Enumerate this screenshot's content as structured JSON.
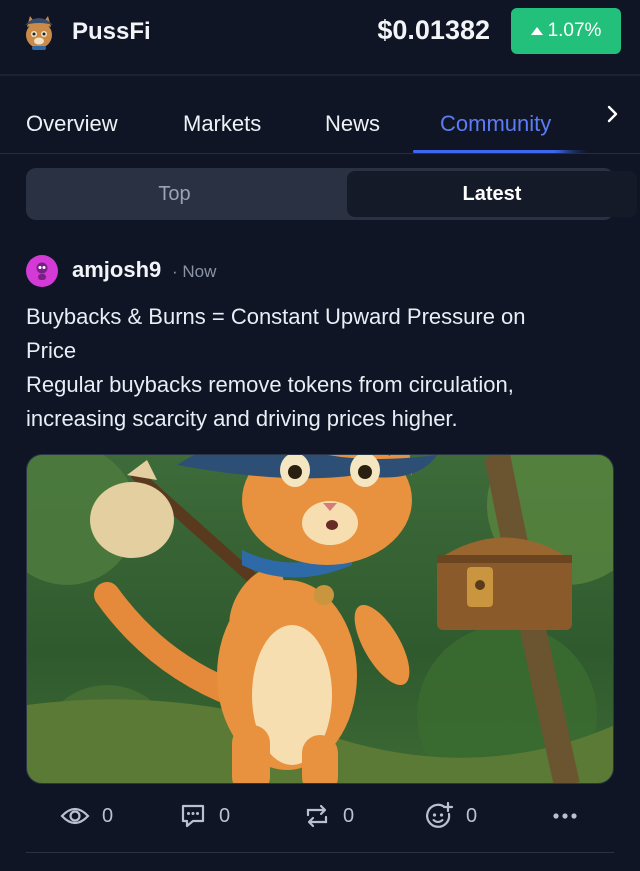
{
  "header": {
    "app_name": "PussFi",
    "price": "$0.01382",
    "change": "1.07%",
    "change_color": "#22c07a"
  },
  "tabs": [
    {
      "label": "Overview"
    },
    {
      "label": "Markets"
    },
    {
      "label": "News"
    },
    {
      "label": "Community",
      "active": true
    }
  ],
  "feed_filter": {
    "options": [
      "Top",
      "Latest"
    ],
    "selected": "Latest"
  },
  "post": {
    "username": "amjosh9",
    "timestamp": "· Now",
    "lines": [
      "Buybacks & Burns = Constant Upward Pressure on",
      "Price",
      "Regular buybacks remove tokens from circulation,",
      "increasing scarcity and driving prices higher."
    ],
    "image_subject": "cartoon-cat-with-bindle-and-treasure-chest",
    "actions": {
      "views": "0",
      "comments": "0",
      "reposts": "0",
      "reactions": "0"
    }
  },
  "colors": {
    "background": "#0f1524",
    "accent": "#3f66f0",
    "avatar": "#d33ad6"
  }
}
